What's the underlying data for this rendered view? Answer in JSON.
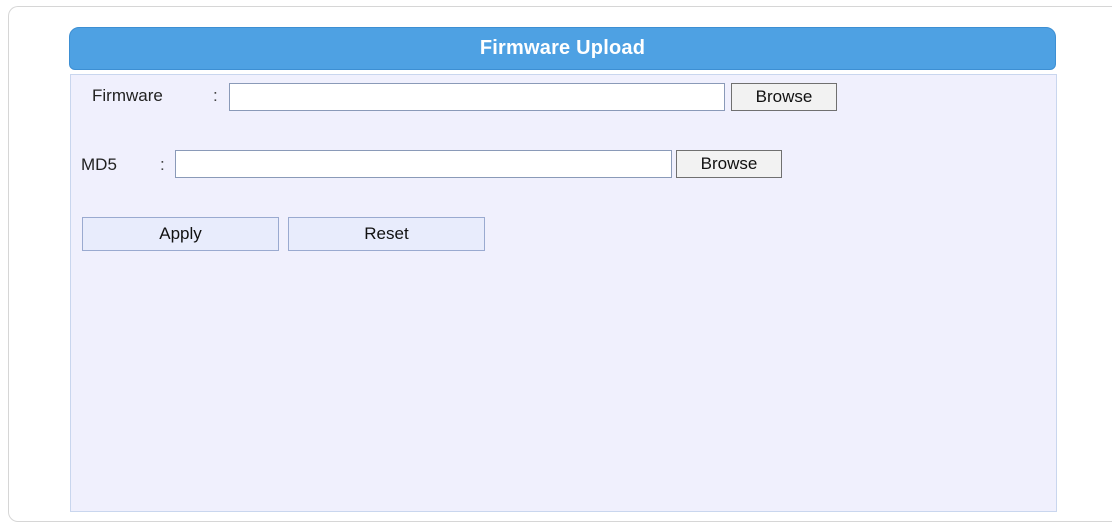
{
  "header": {
    "title": "Firmware Upload"
  },
  "form": {
    "firmware": {
      "label": "Firmware",
      "colon": ":",
      "value": "",
      "browse_label": "Browse"
    },
    "md5": {
      "label": "MD5",
      "colon": ":",
      "value": "",
      "browse_label": "Browse"
    }
  },
  "actions": {
    "apply_label": "Apply",
    "reset_label": "Reset"
  },
  "colors": {
    "header_bg": "#4ea1e3",
    "panel_bg": "#f0f0fd",
    "header_text": "#ffffff"
  }
}
